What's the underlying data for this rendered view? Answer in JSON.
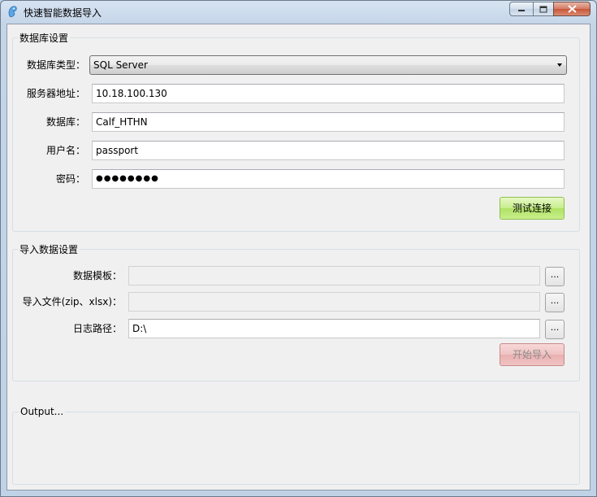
{
  "window": {
    "title": "快速智能数据导入",
    "caption_buttons": {
      "minimize_icon": "minimize-icon",
      "maximize_icon": "maximize-icon",
      "close_icon": "close-icon"
    }
  },
  "db_settings": {
    "legend": "数据库设置",
    "db_type_label": "数据库类型：",
    "db_type_value": "SQL Server",
    "server_label": "服务器地址：",
    "server_value": "10.18.100.130",
    "database_label": "数据库：",
    "database_value": "Calf_HTHN",
    "username_label": "用户名：",
    "username_value": "passport",
    "password_label": "密码：",
    "password_value": "●●●●●●●●",
    "test_button": "测试连接"
  },
  "import_settings": {
    "legend": "导入数据设置",
    "template_label": "数据模板：",
    "template_value": "",
    "import_file_label": "导入文件(zip、xlsx)：",
    "import_file_value": "",
    "log_path_label": "日志路径：",
    "log_path_value": "D:\\",
    "browse_label": "...",
    "start_button": "开始导入"
  },
  "output": {
    "label": "Output..."
  },
  "colors": {
    "test_button": "#c7ee8c",
    "start_button_disabled": "#f0c2c2",
    "client_bg": "#f0f0f0"
  }
}
